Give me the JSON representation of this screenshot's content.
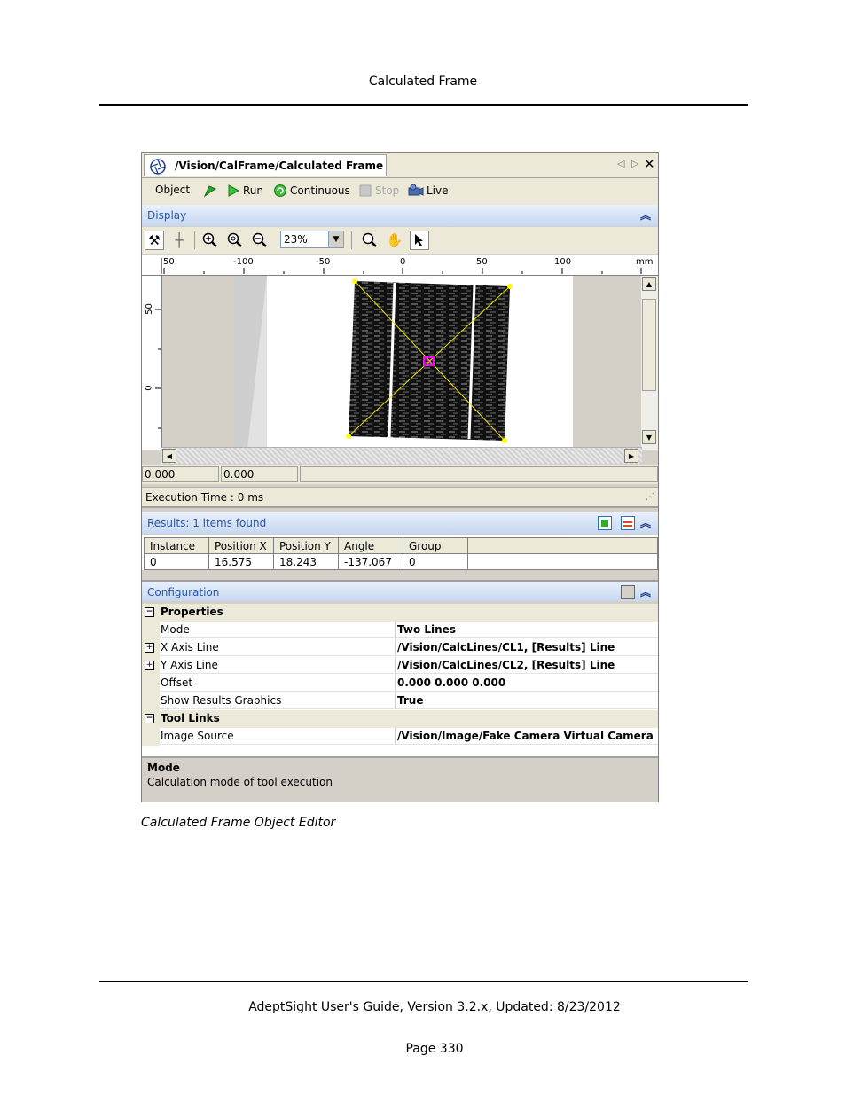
{
  "page": {
    "header": "Calculated Frame",
    "caption": "Calculated Frame Object Editor",
    "footer_line": "AdeptSight User's Guide,  Version 3.2.x, Updated: 8/23/2012",
    "page_number": "Page 330"
  },
  "window": {
    "tab_title": "/Vision/CalFrame/Calculated Frame",
    "toolbar": {
      "object": "Object",
      "run": "Run",
      "continuous": "Continuous",
      "stop": "Stop",
      "live": "Live"
    },
    "display": {
      "section_label": "Display",
      "zoom_value": "23%",
      "ruler_top_labels": [
        "50",
        "-100",
        "-50",
        "0",
        "50",
        "100",
        "mm"
      ],
      "ruler_left_labels": [
        "50",
        "0"
      ],
      "coord_x": "0.000",
      "coord_y": "0.000",
      "execution_time": "Execution Time : 0 ms"
    },
    "results": {
      "section_label": "Results: 1 items found",
      "columns": [
        "Instance",
        "Position X",
        "Position Y",
        "Angle",
        "Group"
      ],
      "rows": [
        [
          "0",
          "16.575",
          "18.243",
          "-137.067",
          "0"
        ]
      ]
    },
    "configuration": {
      "section_label": "Configuration",
      "categories": [
        {
          "name": "Properties",
          "items": [
            {
              "label": "Mode",
              "value": "Two Lines"
            },
            {
              "label": "X Axis Line",
              "value": "/Vision/CalcLines/CL1, [Results] Line"
            },
            {
              "label": "Y Axis Line",
              "value": "/Vision/CalcLines/CL2, [Results] Line"
            },
            {
              "label": "Offset",
              "value": "0.000 0.000 0.000"
            },
            {
              "label": "Show Results Graphics",
              "value": "True"
            }
          ]
        },
        {
          "name": "Tool Links",
          "items": [
            {
              "label": "Image Source",
              "value": "/Vision/Image/Fake Camera Virtual Camera"
            }
          ]
        }
      ],
      "help_title": "Mode",
      "help_text": "Calculation mode of tool execution"
    }
  }
}
